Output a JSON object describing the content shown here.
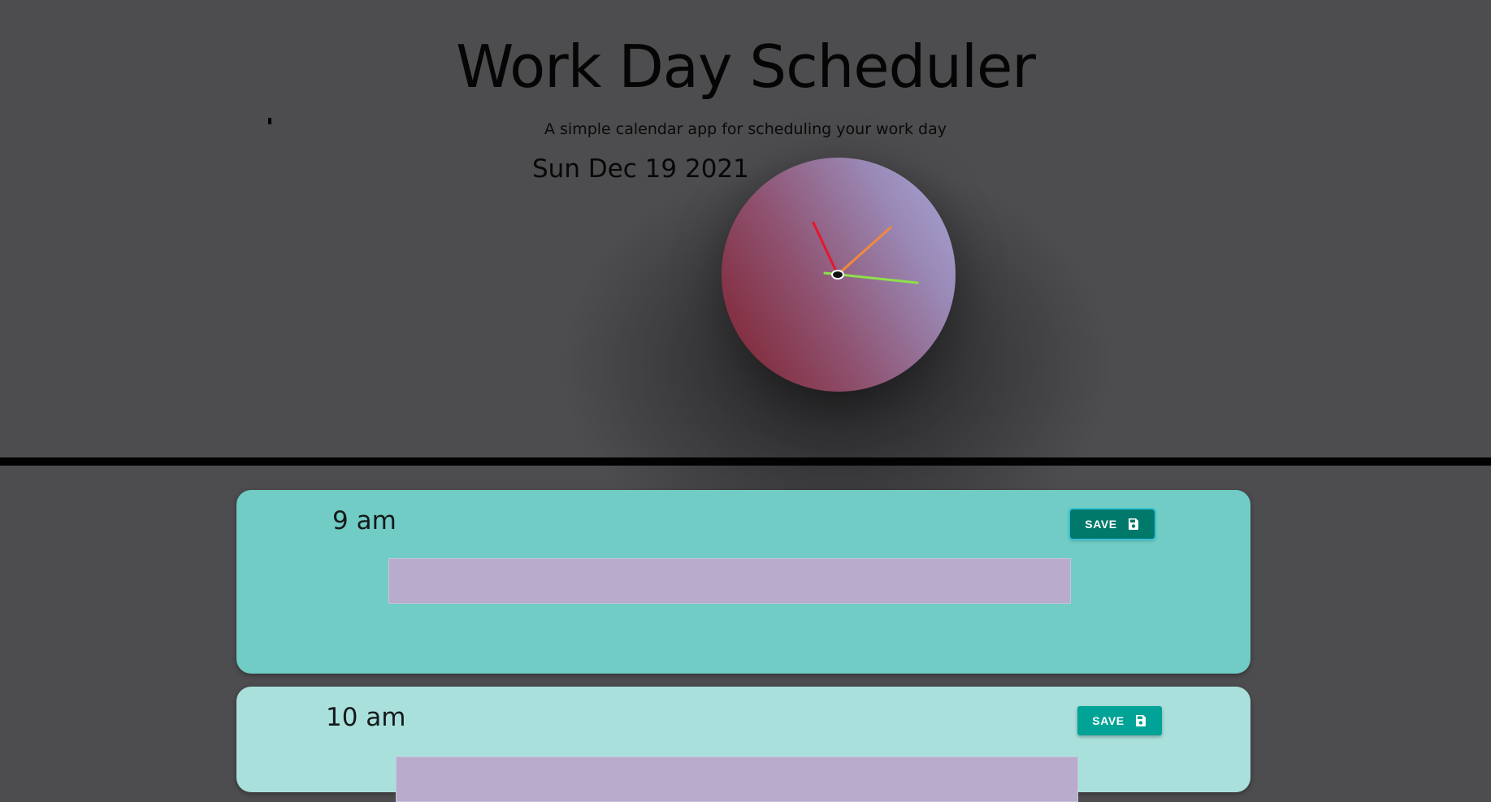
{
  "header": {
    "title": "Work Day Scheduler",
    "subtitle": "A simple calendar app for scheduling your work day",
    "current_day": "Sun Dec 19 2021"
  },
  "clock": {
    "icon": "analog-clock-icon",
    "hand_colors": {
      "hour": "#e8152d",
      "minute": "#f08a3c",
      "second": "#8de04a"
    },
    "face_colors": [
      "#7e1f2b",
      "#a7a7d9"
    ]
  },
  "time_blocks": [
    {
      "hour": "9 am",
      "text": "",
      "save_label": "SAVE",
      "save_icon": "floppy-disk-icon",
      "color": "#70ccc4"
    },
    {
      "hour": "10 am",
      "text": "",
      "save_label": "SAVE",
      "save_icon": "floppy-disk-icon",
      "color": "#aae0dc"
    }
  ],
  "colors": {
    "background": "#4d4c4e",
    "divider": "#020202",
    "save_active": "#00796b",
    "save": "#00a396",
    "textarea": "#b8abcc"
  }
}
